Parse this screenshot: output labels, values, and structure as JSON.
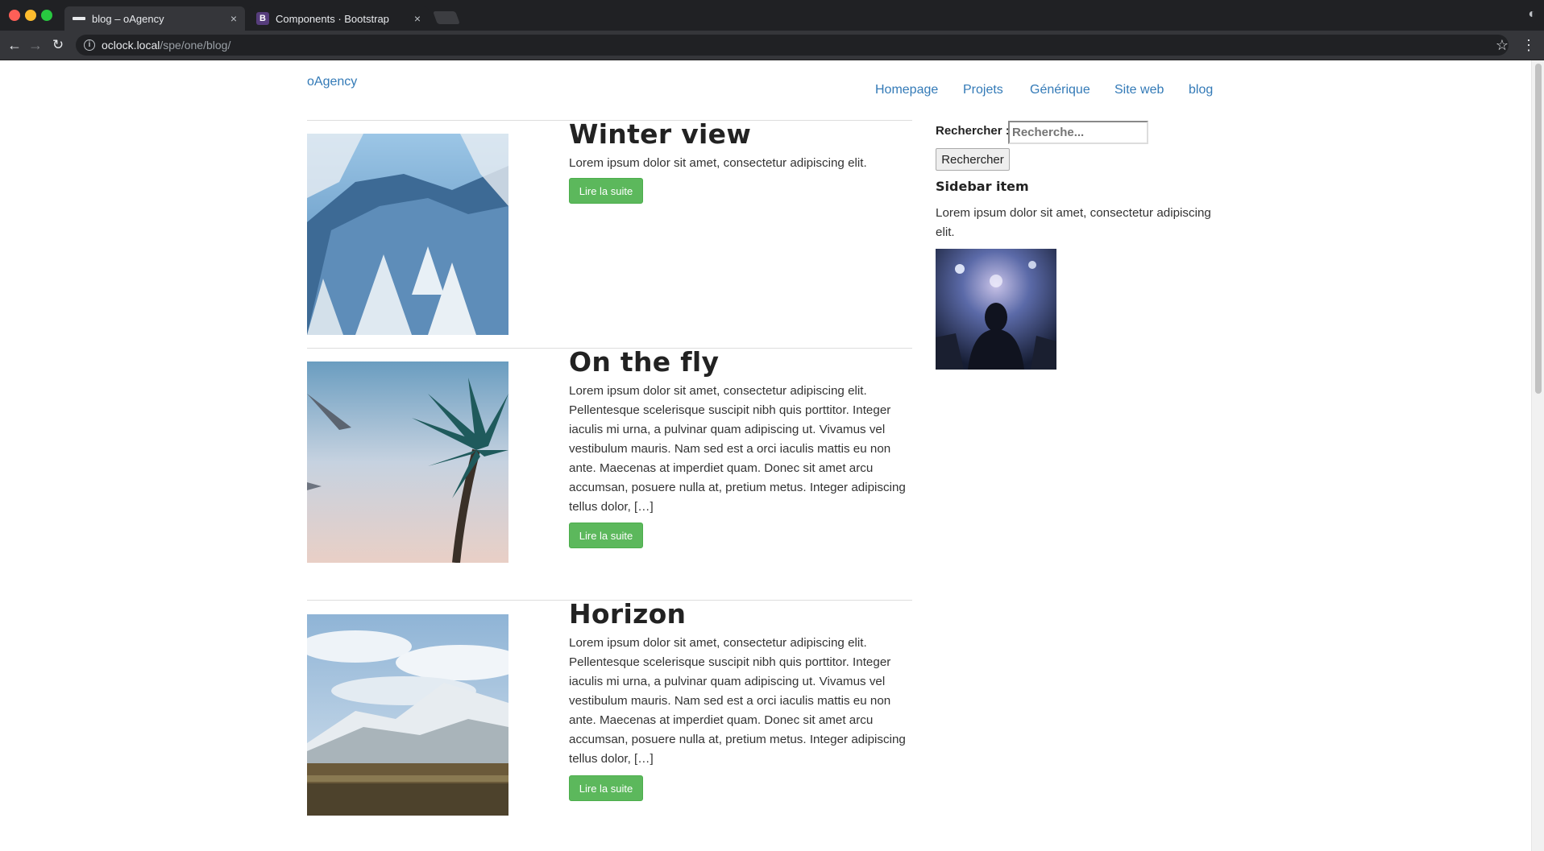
{
  "browser": {
    "tabs": [
      {
        "title": "blog – oAgency",
        "favicon": "oagency-favicon",
        "active": true
      },
      {
        "title": "Components · Bootstrap",
        "favicon": "bootstrap-favicon",
        "favicon_letter": "B",
        "active": false
      }
    ],
    "tab_close_glyph": "×",
    "url_host": "oclock.local",
    "url_path": "/spe/one/blog/"
  },
  "site": {
    "brand": "oAgency",
    "nav": [
      "Homepage",
      "Projets",
      "Générique",
      "Site web",
      "blog"
    ]
  },
  "posts": [
    {
      "title": "Winter view",
      "excerpt": "Lorem ipsum dolor sit amet, consectetur adipiscing elit.",
      "button": "Lire la suite",
      "image": "snowy-mountain-forest"
    },
    {
      "title": "On the fly",
      "excerpt": "Lorem ipsum dolor sit amet, consectetur adipiscing elit. Pellentesque scelerisque suscipit nibh quis porttitor. Integer iaculis mi urna, a pulvinar quam adipiscing ut. Vivamus vel vestibulum mauris. Nam sed est a orci iaculis mattis eu non ante. Maecenas at imperdiet quam. Donec sit amet arcu accumsan, posuere nulla at, pretium metus. Integer adipiscing tellus dolor, […]",
      "button": "Lire la suite",
      "image": "palm-tree-bird-sky"
    },
    {
      "title": "Horizon",
      "excerpt": "Lorem ipsum dolor sit amet, consectetur adipiscing elit. Pellentesque scelerisque suscipit nibh quis porttitor. Integer iaculis mi urna, a pulvinar quam adipiscing ut. Vivamus vel vestibulum mauris. Nam sed est a orci iaculis mattis eu non ante. Maecenas at imperdiet quam. Donec sit amet arcu accumsan, posuere nulla at, pretium metus. Integer adipiscing tellus dolor, […]",
      "button": "Lire la suite",
      "image": "snowy-hills-landscape"
    }
  ],
  "sidebar": {
    "search_label": "Rechercher :",
    "search_placeholder": "Recherche...",
    "search_button": "Rechercher",
    "item_title": "Sidebar item",
    "item_text": "Lorem ipsum dolor sit amet, consectetur adipiscing elit.",
    "item_image": "concert-crowd"
  },
  "colors": {
    "link": "#337ab7",
    "button_success": "#5cb85c",
    "chrome_dark": "#202124"
  }
}
